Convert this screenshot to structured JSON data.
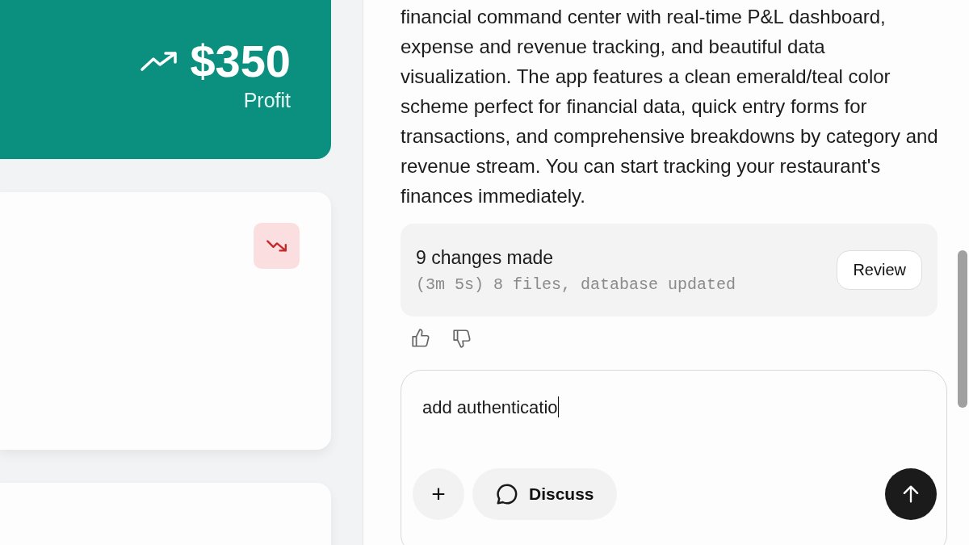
{
  "profit_card": {
    "amount": "$350",
    "label": "Profit"
  },
  "chat": {
    "message": "financial command center with real-time P&L dashboard, expense and revenue tracking, and beautiful data visualization. The app features a clean emerald/teal color scheme perfect for financial data, quick entry forms for transactions, and comprehensive breakdowns by category and revenue stream. You can start tracking your restaurant's finances immediately.",
    "changes": {
      "title": "9 changes made",
      "detail": "(3m 5s) 8 files, database updated",
      "button": "Review"
    }
  },
  "composer": {
    "value": "add authenticatio",
    "buttons": [
      {
        "kind": "add",
        "label": "+"
      },
      {
        "kind": "discuss",
        "label": "Discuss"
      },
      {
        "kind": "send"
      }
    ]
  }
}
